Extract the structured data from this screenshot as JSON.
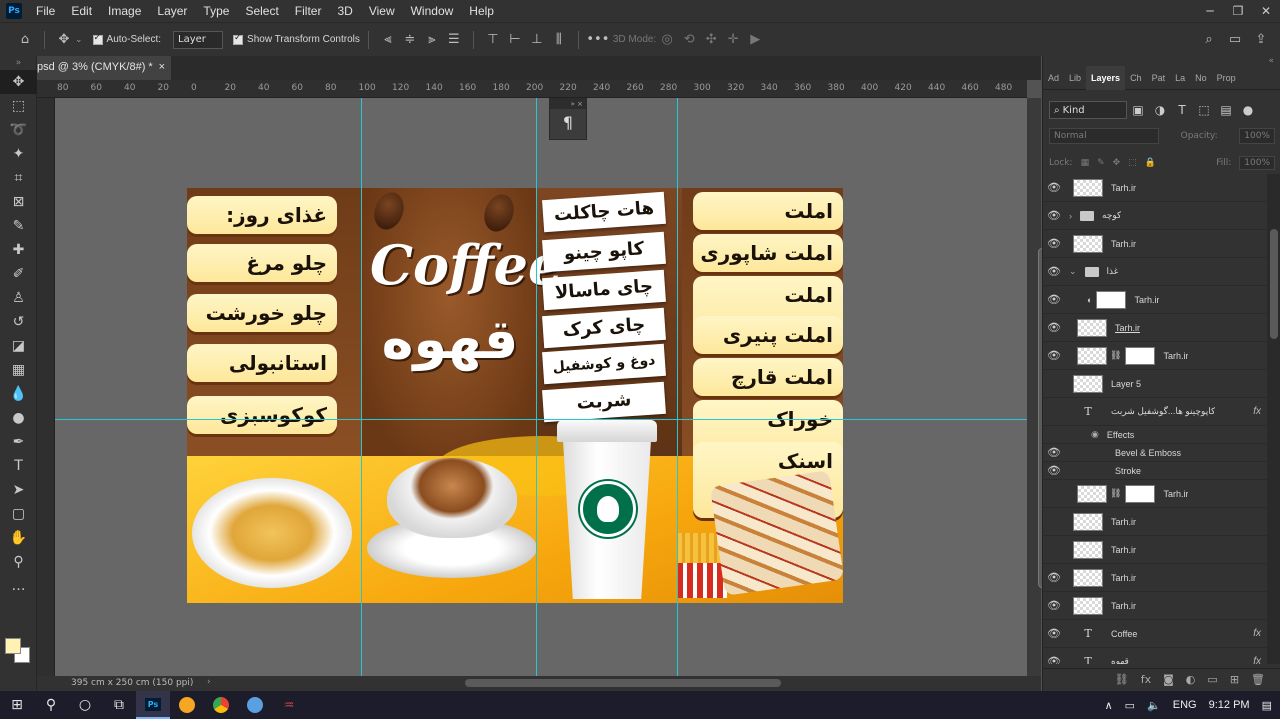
{
  "app": {
    "logo_text": "Ps"
  },
  "menubar": {
    "items": [
      "File",
      "Edit",
      "Image",
      "Layer",
      "Type",
      "Select",
      "Filter",
      "3D",
      "View",
      "Window",
      "Help"
    ]
  },
  "window_controls": [
    "─",
    "❐",
    "✕"
  ],
  "options_bar": {
    "auto_select_label": "Auto-Select:",
    "auto_select_value": "Layer",
    "transform_controls_label": "Show Transform Controls",
    "mode_3d_label": "3D Mode:"
  },
  "document": {
    "tab_title": "psd @ 3% (CMYK/8#) *",
    "status": "395 cm x 250 cm (150 ppi)",
    "ruler_labels": [
      "80",
      "60",
      "40",
      "20",
      "0",
      "20",
      "40",
      "60",
      "80",
      "100",
      "120",
      "140",
      "160",
      "180",
      "200",
      "220",
      "240",
      "260",
      "280",
      "300",
      "320",
      "340",
      "360",
      "380",
      "400",
      "420",
      "440",
      "460",
      "480"
    ]
  },
  "artwork": {
    "left_menu": [
      "غذای روز:",
      "چلو مرغ",
      "چلو خورشت",
      "استانبولی",
      "کوکوسبزی"
    ],
    "drinks_menu": [
      "هات چاکلت",
      "کاپو چینو",
      "چای ماسالا",
      "چای کرک",
      "دوغ و کوشفیل",
      "شربت"
    ],
    "right_menu": [
      "املت",
      "املت شاپوری",
      "املت سوسیس",
      "املت پنیری",
      "املت قارچ",
      "خوراک سوسیس",
      "اسنک مخصوص"
    ],
    "title_en": "Coffee",
    "title_fa": "قهوه"
  },
  "right_panel": {
    "tabs": [
      "Ad",
      "Lib",
      "Layers",
      "Ch",
      "Pat",
      "La",
      "No",
      "Prop"
    ],
    "active_tab": "Layers",
    "filter_kind": "Kind",
    "blend_mode": "Normal",
    "opacity_label": "Opacity:",
    "opacity_value": "100%",
    "lock_label": "Lock:",
    "fill_label": "Fill:",
    "fill_value": "100%",
    "layers": [
      {
        "name": "Tarh.ir",
        "visible": true,
        "kind": "pixel"
      },
      {
        "name": "کوچه",
        "visible": true,
        "kind": "group"
      },
      {
        "name": "Tarh.ir",
        "visible": true,
        "kind": "pixel"
      },
      {
        "name": "غذا",
        "visible": true,
        "kind": "group-open"
      },
      {
        "name": "Tarh.ir",
        "visible": true,
        "kind": "adjust"
      },
      {
        "name": "Tarh.ir",
        "visible": true,
        "kind": "pixel-linked"
      },
      {
        "name": "Tarh.ir",
        "visible": true,
        "kind": "masked"
      },
      {
        "name": "Layer 5",
        "visible": false,
        "kind": "pixel"
      },
      {
        "name": "کاپوچینو ها...گوشفیل شربت",
        "visible": false,
        "kind": "text-fx"
      },
      {
        "name": "Effects",
        "visible": true,
        "kind": "effects"
      },
      {
        "name": "Bevel & Emboss",
        "visible": true,
        "kind": "effect"
      },
      {
        "name": "Stroke",
        "visible": true,
        "kind": "effect"
      },
      {
        "name": "Tarh.ir",
        "visible": false,
        "kind": "masked"
      },
      {
        "name": "Tarh.ir",
        "visible": false,
        "kind": "pixel"
      },
      {
        "name": "Tarh.ir",
        "visible": false,
        "kind": "pixel"
      },
      {
        "name": "Tarh.ir",
        "visible": true,
        "kind": "pixel"
      },
      {
        "name": "Tarh.ir",
        "visible": true,
        "kind": "pixel"
      },
      {
        "name": "Coffee",
        "visible": true,
        "kind": "text-fx"
      },
      {
        "name": "قهوه",
        "visible": true,
        "kind": "text-fx"
      }
    ]
  },
  "taskbar": {
    "language": "ENG",
    "time": "9:12 PM"
  }
}
